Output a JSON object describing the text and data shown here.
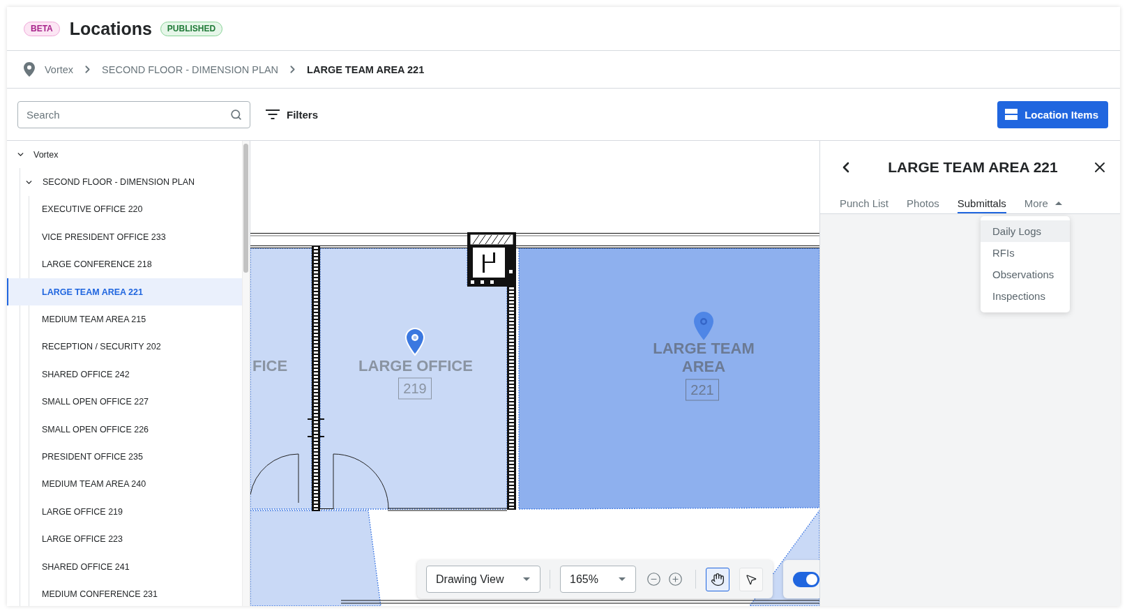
{
  "header": {
    "beta_badge": "BETA",
    "title": "Locations",
    "status_badge": "PUBLISHED"
  },
  "breadcrumb": [
    {
      "label": "Vortex",
      "current": false
    },
    {
      "label": "SECOND FLOOR - DIMENSION PLAN",
      "current": false
    },
    {
      "label": "LARGE TEAM AREA 221",
      "current": true
    }
  ],
  "toolbar": {
    "search": {
      "placeholder": "Search"
    },
    "filters": "Filters",
    "location_items": "Location Items"
  },
  "tree": [
    {
      "label": "Vortex",
      "expanded": true,
      "selected": false,
      "children": [
        {
          "label": "SECOND FLOOR - DIMENSION PLAN",
          "expanded": true,
          "selected": false,
          "children": [
            {
              "label": "EXECUTIVE OFFICE 220",
              "selected": false
            },
            {
              "label": "VICE PRESIDENT OFFICE 233",
              "selected": false
            },
            {
              "label": "LARGE CONFERENCE 218",
              "selected": false
            },
            {
              "label": "LARGE TEAM AREA 221",
              "selected": true
            },
            {
              "label": "MEDIUM TEAM AREA 215",
              "selected": false
            },
            {
              "label": "RECEPTION / SECURITY 202",
              "selected": false
            },
            {
              "label": "SHARED OFFICE 242",
              "selected": false
            },
            {
              "label": "SMALL OPEN OFFICE 227",
              "selected": false
            },
            {
              "label": "SMALL OPEN OFFICE 226",
              "selected": false
            },
            {
              "label": "PRESIDENT OFFICE 235",
              "selected": false
            },
            {
              "label": "MEDIUM TEAM AREA 240",
              "selected": false
            },
            {
              "label": "LARGE OFFICE 219",
              "selected": false
            },
            {
              "label": "LARGE OFFICE 223",
              "selected": false
            },
            {
              "label": "SHARED OFFICE 241",
              "selected": false
            },
            {
              "label": "MEDIUM CONFERENCE 231",
              "selected": false
            }
          ]
        }
      ]
    }
  ],
  "floor_plan": {
    "rooms": [
      {
        "label_lines": [
          "FICE"
        ],
        "selected": false,
        "pinned": false
      },
      {
        "label_lines": [
          "LARGE OFFICE"
        ],
        "number": "219",
        "selected": false,
        "pinned": true
      },
      {
        "label_lines": [
          "LARGE TEAM",
          "AREA"
        ],
        "number": "221",
        "selected": true,
        "pinned": true
      }
    ]
  },
  "plan_toolbar": {
    "view": "Drawing View",
    "zoom": "165%",
    "tools": [
      {
        "kind": "hand",
        "selected": true
      },
      {
        "kind": "pointer",
        "selected": false
      }
    ],
    "toggle": {
      "on": true
    }
  },
  "detail_panel": {
    "title": "LARGE TEAM AREA 221",
    "tabs": [
      {
        "label": "Punch List",
        "kind": "tab",
        "selected": false
      },
      {
        "label": "Photos",
        "kind": "tab",
        "selected": false
      },
      {
        "label": "Submittals",
        "kind": "tab",
        "selected": true
      },
      {
        "label": "More",
        "kind": "menu",
        "selected": false,
        "expanded": true,
        "items": [
          {
            "label": "Daily Logs",
            "selected": true
          },
          {
            "label": "RFIs",
            "selected": false
          },
          {
            "label": "Observations",
            "selected": false
          },
          {
            "label": "Inspections",
            "selected": false
          }
        ]
      }
    ]
  }
}
